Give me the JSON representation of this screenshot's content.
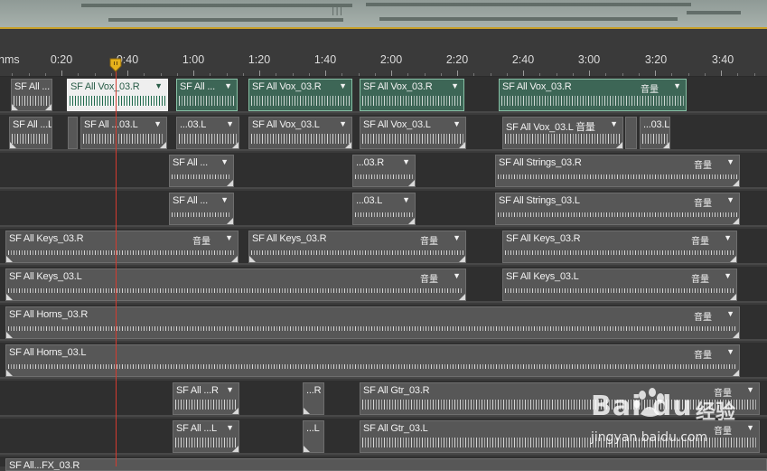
{
  "overview": {
    "handle_glyph": "|||"
  },
  "ruler": {
    "unit_label": "hms",
    "ticks": [
      "0:20",
      "0:40",
      "1:00",
      "1:20",
      "1:40",
      "2:00",
      "2:20",
      "2:40",
      "3:00",
      "3:20",
      "3:40"
    ]
  },
  "tracks": [
    {
      "clips": [
        {
          "name": "SF All ...",
          "menu": "▼",
          "selected": false
        },
        {
          "name": "SF All Vox_03.R",
          "menu": "▼",
          "selected": true
        },
        {
          "name": "SF All ...",
          "menu": "▼",
          "selected": true
        },
        {
          "name": "SF All Vox_03.R",
          "menu": "▼",
          "selected": true
        },
        {
          "name": "SF All Vox_03.R",
          "menu": "▼",
          "selected": true
        },
        {
          "name": "SF All Vox_03.R",
          "gain": "音量",
          "menu": "▼",
          "selected": true
        }
      ]
    },
    {
      "clips": [
        {
          "name": "SF All ...L",
          "menu": "",
          "selected": false
        },
        {
          "name": "",
          "menu": "",
          "selected": false
        },
        {
          "name": "SF All ...03.L",
          "menu": "▼",
          "selected": false
        },
        {
          "name": "...03.L",
          "menu": "▼",
          "selected": false
        },
        {
          "name": "SF All Vox_03.L",
          "menu": "▼",
          "selected": false
        },
        {
          "name": "SF All Vox_03.L",
          "menu": "▼",
          "selected": false
        },
        {
          "name": "SF All Vox_03.L 音量",
          "menu": "▼",
          "selected": false
        },
        {
          "name": "",
          "menu": "",
          "selected": false
        },
        {
          "name": "...03.L",
          "menu": "",
          "selected": false
        }
      ]
    },
    {
      "clips": [
        {
          "name": "SF All ...",
          "menu": "▼",
          "selected": false
        },
        {
          "name": "...03.R",
          "menu": "▼",
          "selected": false
        },
        {
          "name": "SF All Strings_03.R",
          "gain": "音量",
          "menu": "▼",
          "selected": false
        }
      ]
    },
    {
      "clips": [
        {
          "name": "SF All ...",
          "menu": "▼",
          "selected": false
        },
        {
          "name": "...03.L",
          "menu": "▼",
          "selected": false
        },
        {
          "name": "SF All Strings_03.L",
          "gain": "音量",
          "menu": "▼",
          "selected": false
        }
      ]
    },
    {
      "clips": [
        {
          "name": "SF All Keys_03.R",
          "gain": "音量",
          "menu": "▼",
          "selected": false
        },
        {
          "name": "SF All Keys_03.R",
          "gain": "音量",
          "menu": "▼",
          "selected": false
        },
        {
          "name": "SF All Keys_03.R",
          "gain": "音量",
          "menu": "▼",
          "selected": false
        }
      ]
    },
    {
      "clips": [
        {
          "name": "SF All Keys_03.L",
          "gain": "音量",
          "menu": "▼",
          "selected": false
        },
        {
          "name": "SF All Keys_03.L",
          "gain": "音量",
          "menu": "▼",
          "selected": false
        }
      ]
    },
    {
      "clips": [
        {
          "name": "SF All Horns_03.R",
          "gain": "音量",
          "menu": "▼",
          "selected": false
        }
      ]
    },
    {
      "clips": [
        {
          "name": "SF All Horns_03.L",
          "gain": "音量",
          "menu": "▼",
          "selected": false
        }
      ]
    },
    {
      "clips": [
        {
          "name": "SF All ...R",
          "menu": "▼",
          "selected": false
        },
        {
          "name": "...R",
          "menu": "",
          "selected": false
        },
        {
          "name": "SF All Gtr_03.R",
          "gain": "音量",
          "menu": "▼",
          "selected": false
        }
      ]
    },
    {
      "clips": [
        {
          "name": "SF All ...L",
          "menu": "▼",
          "selected": false
        },
        {
          "name": "...L",
          "menu": "",
          "selected": false
        },
        {
          "name": "SF All Gtr_03.L",
          "gain": "音量",
          "menu": "▼",
          "selected": false
        }
      ]
    },
    {
      "clips": [
        {
          "name": "SF All...FX_03.R",
          "menu": "",
          "selected": false
        }
      ]
    }
  ],
  "playhead": {
    "time_label": ""
  },
  "watermark": {
    "logo": "Bai du",
    "cn": "经验",
    "url": "jingyan.baidu.com"
  }
}
